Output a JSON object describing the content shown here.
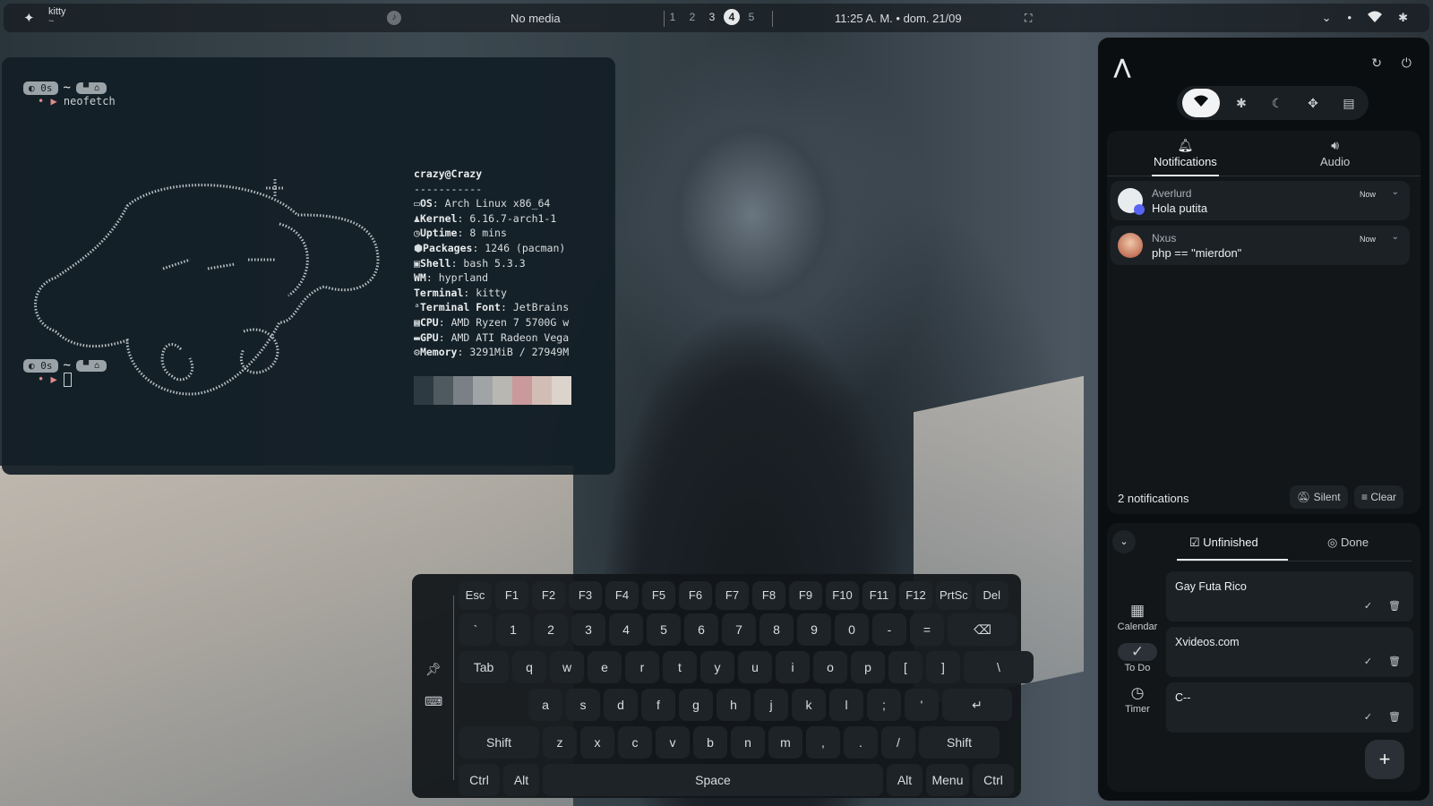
{
  "topbar": {
    "logo_icon": "sparkle-icon",
    "window_title": "kitty",
    "window_subtitle": "~",
    "media_text": "No media",
    "workspaces": [
      "1",
      "2",
      "3",
      "4",
      "5"
    ],
    "active_workspace": "4",
    "clock": "11:25 A. M. • dom. 21/09"
  },
  "terminal": {
    "prompt1": {
      "time": "0s",
      "tilde": "~",
      "command": "neofetch"
    },
    "prompt2": {
      "time": "0s",
      "tilde": "~",
      "command": ""
    },
    "user_host": "crazy@Crazy",
    "separator": "-----------",
    "info": [
      {
        "key": "OS",
        "value": "Arch Linux x86_64"
      },
      {
        "key": "Kernel",
        "value": "6.16.7-arch1-1"
      },
      {
        "key": "Uptime",
        "value": "8 mins"
      },
      {
        "key": "Packages",
        "value": "1246 (pacman)"
      },
      {
        "key": "Shell",
        "value": "bash 5.3.3"
      },
      {
        "key": "WM",
        "value": "hyprland"
      },
      {
        "key": "Terminal",
        "value": "kitty"
      },
      {
        "key": "Terminal Font",
        "value": "JetBrains"
      },
      {
        "key": "CPU",
        "value": "AMD Ryzen 7 5700G w"
      },
      {
        "key": "GPU",
        "value": "AMD ATI Radeon Vega"
      },
      {
        "key": "Memory",
        "value": "3291MiB / 27949M"
      }
    ],
    "palette": [
      "#2e3a41",
      "#4f5a60",
      "#7a8085",
      "#a0a4a6",
      "#b9b7b2",
      "#c9999c",
      "#d2bdb5",
      "#dcd3cc"
    ]
  },
  "panel": {
    "quick_toggles": [
      "wifi-icon",
      "bluetooth-icon",
      "moon-icon",
      "gamepad-icon",
      "clipboard-icon"
    ],
    "tabs": {
      "notifications": "Notifications",
      "audio": "Audio"
    },
    "notifications": [
      {
        "app": "Averlurd",
        "message": "Hola putita",
        "time": "Now"
      },
      {
        "app": "Nxus",
        "message": "php == \"mierdon\"",
        "time": "Now"
      }
    ],
    "count": "2 notifications",
    "silent_label": "Silent",
    "clear_label": "Clear",
    "todo_tabs": {
      "unfinished": "Unfinished",
      "done": "Done"
    },
    "nav": {
      "calendar": "Calendar",
      "todo": "To Do",
      "timer": "Timer"
    },
    "todos": [
      "Gay Futa Rico",
      "Xvideos.com",
      "C--"
    ],
    "add_label": "+"
  },
  "keyboard": {
    "rows": [
      [
        "Esc",
        "F1",
        "F2",
        "F3",
        "F4",
        "F5",
        "F6",
        "F7",
        "F8",
        "F9",
        "F10",
        "F11",
        "F12",
        "PrtSc",
        "Del"
      ],
      [
        "`",
        "1",
        "2",
        "3",
        "4",
        "5",
        "6",
        "7",
        "8",
        "9",
        "0",
        "-",
        "=",
        "⌫"
      ],
      [
        "Tab",
        "q",
        "w",
        "e",
        "r",
        "t",
        "y",
        "u",
        "i",
        "o",
        "p",
        "[",
        "]",
        "\\"
      ],
      [
        "a",
        "s",
        "d",
        "f",
        "g",
        "h",
        "j",
        "k",
        "l",
        ";",
        "'",
        "↵"
      ],
      [
        "Shift",
        "z",
        "x",
        "c",
        "v",
        "b",
        "n",
        "m",
        ",",
        ".",
        "/",
        "Shift"
      ],
      [
        "Ctrl",
        "Alt",
        "Space",
        "Alt",
        "Menu",
        "Ctrl"
      ]
    ]
  }
}
